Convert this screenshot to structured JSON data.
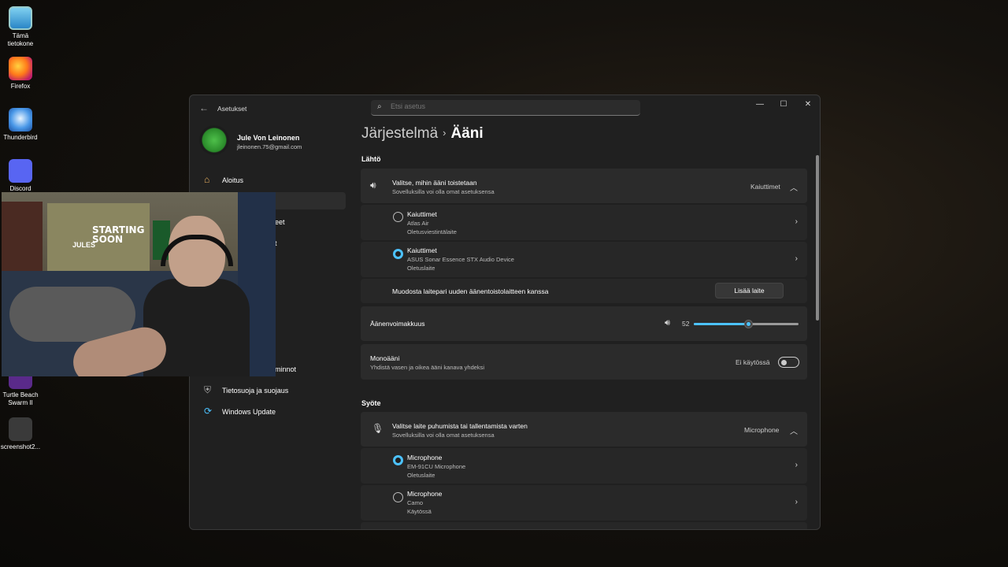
{
  "desktop": {
    "icons": [
      {
        "label": "Tämä tietokone",
        "icon": "computer-icon"
      },
      {
        "label": "Firefox",
        "icon": "firefox-icon"
      },
      {
        "label": "Thunderbird",
        "icon": "thunderbird-icon"
      },
      {
        "label": "Discord",
        "icon": "discord-icon"
      },
      {
        "label": "Turtle Beach Swarm II",
        "icon": "turtle-beach-icon"
      },
      {
        "label": "screenshot2...",
        "icon": "screenshot-file-icon"
      }
    ]
  },
  "window": {
    "title": "Asetukset",
    "search_placeholder": "Etsi asetus"
  },
  "user": {
    "name": "Jule Von Leinonen",
    "email": "jleinonen.75@gmail.com"
  },
  "nav": {
    "home": "Aloitus",
    "partial_1": "eet",
    "partial_2": "t",
    "partial_3": "minnot",
    "privacy": "Tietosuoja ja suojaus",
    "update": "Windows Update"
  },
  "breadcrumb": {
    "parent": "Järjestelmä",
    "separator": "›",
    "current": "Ääni"
  },
  "output": {
    "section": "Lähtö",
    "header_title": "Valitse, mihin ääni toistetaan",
    "header_sub": "Sovelluksilla voi olla omat asetuksensa",
    "header_value": "Kaiuttimet",
    "devices": [
      {
        "name": "Kaiuttimet",
        "device": "Atlas Air",
        "status": "Oletusviestintälaite",
        "selected": false
      },
      {
        "name": "Kaiuttimet",
        "device": "ASUS Sonar Essence STX Audio Device",
        "status": "Oletuslaite",
        "selected": true
      }
    ],
    "pair_label": "Muodosta laitepari uuden äänentoistolaitteen kanssa",
    "pair_button": "Lisää laite",
    "volume_label": "Äänenvoimakkuus",
    "volume_value": "52",
    "volume_level": 52,
    "mono_title": "Monoääni",
    "mono_sub": "Yhdistä vasen ja oikea ääni kanava yhdeksi",
    "mono_state": "Ei käytössä"
  },
  "input": {
    "section": "Syöte",
    "header_title": "Valitse laite puhumista tai tallentamista varten",
    "header_sub": "Sovelluksilla voi olla omat asetuksensa",
    "header_value": "Microphone",
    "devices": [
      {
        "name": "Microphone",
        "device": "EM-91CU Microphone",
        "status": "Oletuslaite",
        "selected": true
      },
      {
        "name": "Microphone",
        "device": "Camo",
        "status": "Käytössä",
        "selected": false
      }
    ]
  },
  "webcam": {
    "poster_text": "STARTING SOON",
    "poster_tag": "JULES"
  },
  "colors": {
    "accent": "#4cc2ff",
    "window_bg": "#202020",
    "card_bg": "#2b2b2b"
  }
}
